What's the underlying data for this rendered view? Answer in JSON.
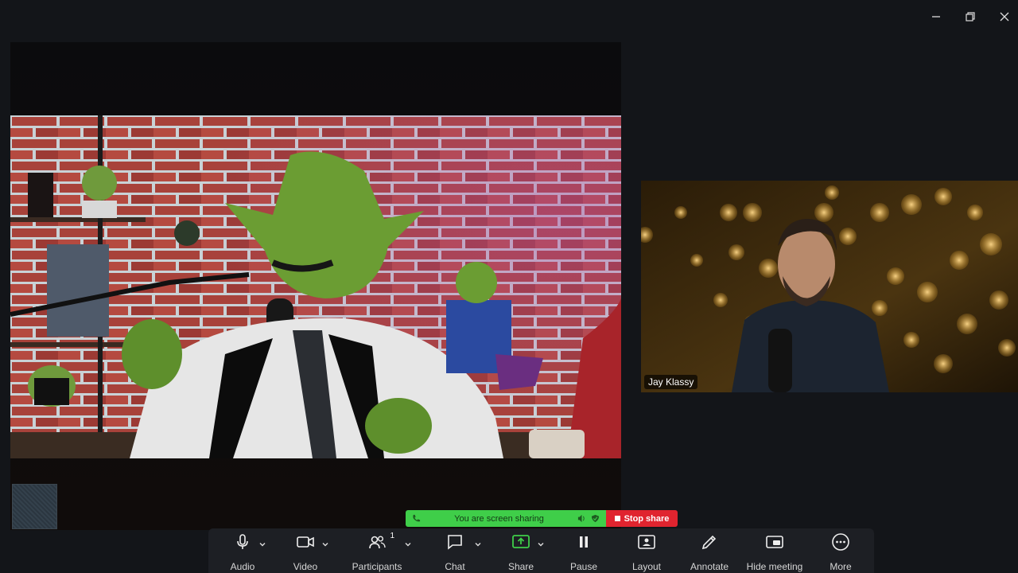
{
  "window": {
    "controls": [
      "minimize",
      "restore",
      "close"
    ]
  },
  "participant": {
    "name": "Jay Klassy"
  },
  "sharing_banner": {
    "status_text": "You are screen sharing",
    "stop_label": "Stop share",
    "colors": {
      "bar": "#3fce49",
      "stop": "#e0242f"
    }
  },
  "toolbar": {
    "audio": "Audio",
    "video": "Video",
    "participants": "Participants",
    "participants_count": "1",
    "chat": "Chat",
    "share": "Share",
    "pause": "Pause",
    "layout": "Layout",
    "annotate": "Annotate",
    "hide_meeting": "Hide meeting",
    "more": "More"
  },
  "icons": [
    "minimize-icon",
    "restore-icon",
    "close-icon",
    "microphone-icon",
    "video-camera-icon",
    "participants-icon",
    "chat-icon",
    "share-screen-icon",
    "pause-icon",
    "layout-icon",
    "pencil-icon",
    "hide-meeting-icon",
    "more-icon",
    "phone-icon",
    "speaker-icon",
    "shield-icon"
  ]
}
